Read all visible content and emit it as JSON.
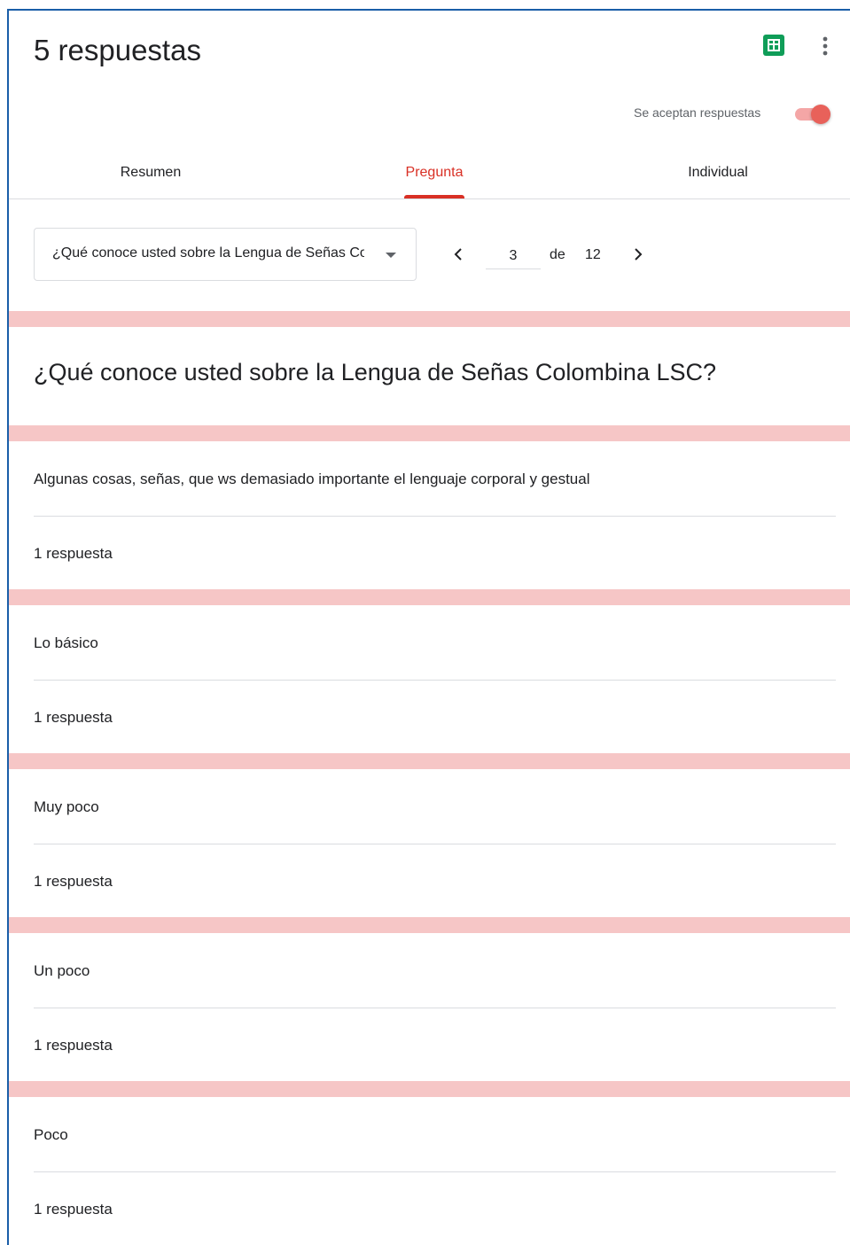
{
  "header": {
    "title": "5 respuestas",
    "sheets_icon": "google-sheets-icon",
    "more_icon": "more-vert-icon",
    "accepting_label": "Se aceptan respuestas",
    "accepting_enabled": true,
    "accent_color": "#d93025"
  },
  "tabs": [
    {
      "label": "Resumen",
      "active": false
    },
    {
      "label": "Pregunta",
      "active": true
    },
    {
      "label": "Individual",
      "active": false
    }
  ],
  "navigator": {
    "selected_question": "¿Qué conoce usted sobre la Lengua de Señas Colombina LSC?",
    "current_page": "3",
    "of_label": "de",
    "total_pages": "12"
  },
  "question": {
    "title": "¿Qué conoce usted sobre la Lengua de Señas Colombina LSC?"
  },
  "answers": [
    {
      "text": "Algunas cosas, señas, que ws demasiado importante el lenguaje corporal y gestual",
      "count": "1 respuesta"
    },
    {
      "text": "Lo básico",
      "count": "1 respuesta"
    },
    {
      "text": "Muy poco",
      "count": "1 respuesta"
    },
    {
      "text": "Un poco",
      "count": "1 respuesta"
    },
    {
      "text": "Poco",
      "count": "1 respuesta"
    }
  ]
}
